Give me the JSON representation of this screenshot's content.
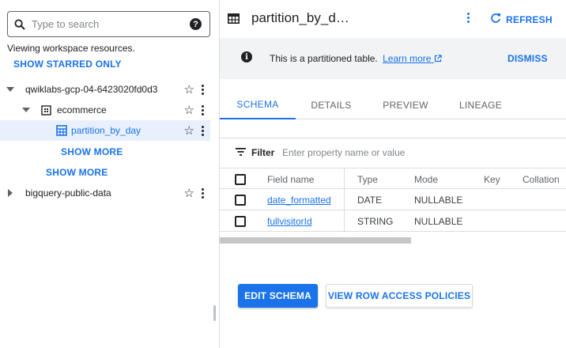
{
  "explorer": {
    "search_placeholder": "Type to search",
    "help_symbol": "?",
    "viewing_text": "Viewing workspace resources.",
    "show_starred": "SHOW STARRED ONLY",
    "tree": {
      "project": "qwiklabs-gcp-04-6423020fd0d3",
      "dataset": "ecommerce",
      "table": "partition_by_day",
      "show_more_tables": "SHOW MORE",
      "show_more_datasets": "SHOW MORE",
      "public_project": "bigquery-public-data"
    }
  },
  "header": {
    "title": "partition_by_d…",
    "refresh_label": "REFRESH"
  },
  "banner": {
    "info_symbol": "i",
    "message": "This is a partitioned table.",
    "learn_more": "Learn more",
    "dismiss": "DISMISS"
  },
  "tabs": [
    {
      "label": "SCHEMA",
      "active": true
    },
    {
      "label": "DETAILS",
      "active": false
    },
    {
      "label": "PREVIEW",
      "active": false
    },
    {
      "label": "LINEAGE",
      "active": false
    }
  ],
  "schema": {
    "filter_label": "Filter",
    "filter_placeholder": "Enter property name or value",
    "columns": [
      "Field name",
      "Type",
      "Mode",
      "Key",
      "Collation"
    ],
    "rows": [
      {
        "name": "date_formatted",
        "type": "DATE",
        "mode": "NULLABLE"
      },
      {
        "name": "fullvisitorId",
        "type": "STRING",
        "mode": "NULLABLE"
      }
    ]
  },
  "actions": {
    "edit_schema": "EDIT SCHEMA",
    "view_row_access": "VIEW ROW ACCESS POLICIES"
  },
  "colors": {
    "accent": "#1a73e8",
    "selected_bg": "#e8f0fe",
    "banner_bg": "#f1f3f4"
  }
}
